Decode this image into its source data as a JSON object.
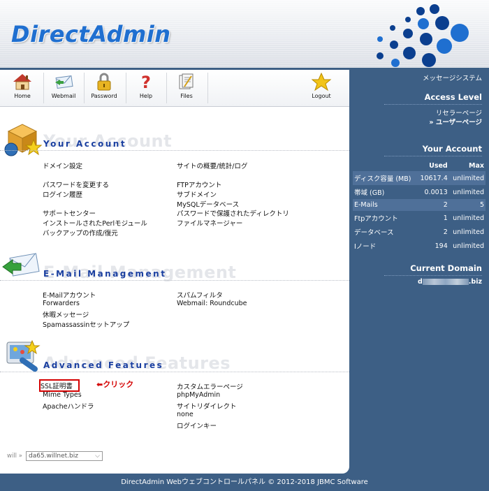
{
  "header": {
    "logo_text": "DirectAdmin"
  },
  "toolbar": {
    "items": [
      {
        "label": "Home",
        "icon": "house-icon"
      },
      {
        "label": "Webmail",
        "icon": "mail-icon"
      },
      {
        "label": "Password",
        "icon": "padlock-icon"
      },
      {
        "label": "Help",
        "icon": "question-icon"
      },
      {
        "label": "Files",
        "icon": "files-icon"
      },
      {
        "label": "Logout",
        "icon": "star-icon"
      }
    ]
  },
  "sections": {
    "account": {
      "title": "Your Account",
      "ghost": "Your Account",
      "links": [
        "ドメイン設定",
        "サイトの概要/統計/ログ",
        "パスワードを変更する",
        "FTPアカウント",
        "ログイン履歴",
        "サブドメイン",
        "MySQLデータベース",
        "サポートセンター",
        "パスワードで保護されたディレクトリ",
        "インストールされたPerlモジュール",
        "ファイルマネージャー",
        "バックアップの作成/復元"
      ]
    },
    "email": {
      "title": "E-Mail Management",
      "ghost": "E-Mail Management",
      "links": [
        "E-Mailアカウント",
        "スパムフィルタ",
        "Forwarders",
        "Webmail: Roundcube",
        "休暇メッセージ",
        "Spamassassinセットアップ"
      ]
    },
    "advanced": {
      "title": "Advanced Features",
      "ghost": "Advanced Features",
      "links": [
        "SSL証明書",
        "カスタムエラーページ",
        "Mime Types",
        "phpMyAdmin",
        "Apacheハンドラ",
        "サイトリダイレクト",
        "none",
        "ログインキー"
      ]
    }
  },
  "annotation": {
    "text": "クリック",
    "arrow": "⬅",
    "color": "#d40000"
  },
  "server": {
    "label": "will »",
    "selected": "da65.willnet.biz"
  },
  "sidebar": {
    "message_system": "メッセージシステム",
    "access_level": {
      "heading": "Access Level",
      "reseller": "リセラーページ",
      "user_prefix": "»",
      "user": "ユーザーページ"
    },
    "your_account": {
      "heading": "Your Account",
      "columns": [
        "Used",
        "Max"
      ],
      "rows": [
        {
          "name": "ディスク容量 (MB)",
          "used": "10617.4",
          "max": "unlimited"
        },
        {
          "name": "帯域 (GB)",
          "used": "0.0013",
          "max": "unlimited"
        },
        {
          "name": "E-Mails",
          "used": "2",
          "max": "5"
        },
        {
          "name": "Ftpアカウント",
          "used": "1",
          "max": "unlimited"
        },
        {
          "name": "データベース",
          "used": "2",
          "max": "unlimited"
        },
        {
          "name": "Iノード",
          "used": "194",
          "max": "unlimited"
        }
      ]
    },
    "current_domain": {
      "heading": "Current Domain",
      "domain_start": "d",
      "domain_end": ".biz"
    }
  },
  "footer": {
    "text": "DirectAdmin Webウェブコントロールパネル © 2012-2018 JBMC Software"
  },
  "colors": {
    "accent": "#1a3fa0",
    "sidebar": "#3d5f85",
    "highlight": "#d40000"
  }
}
